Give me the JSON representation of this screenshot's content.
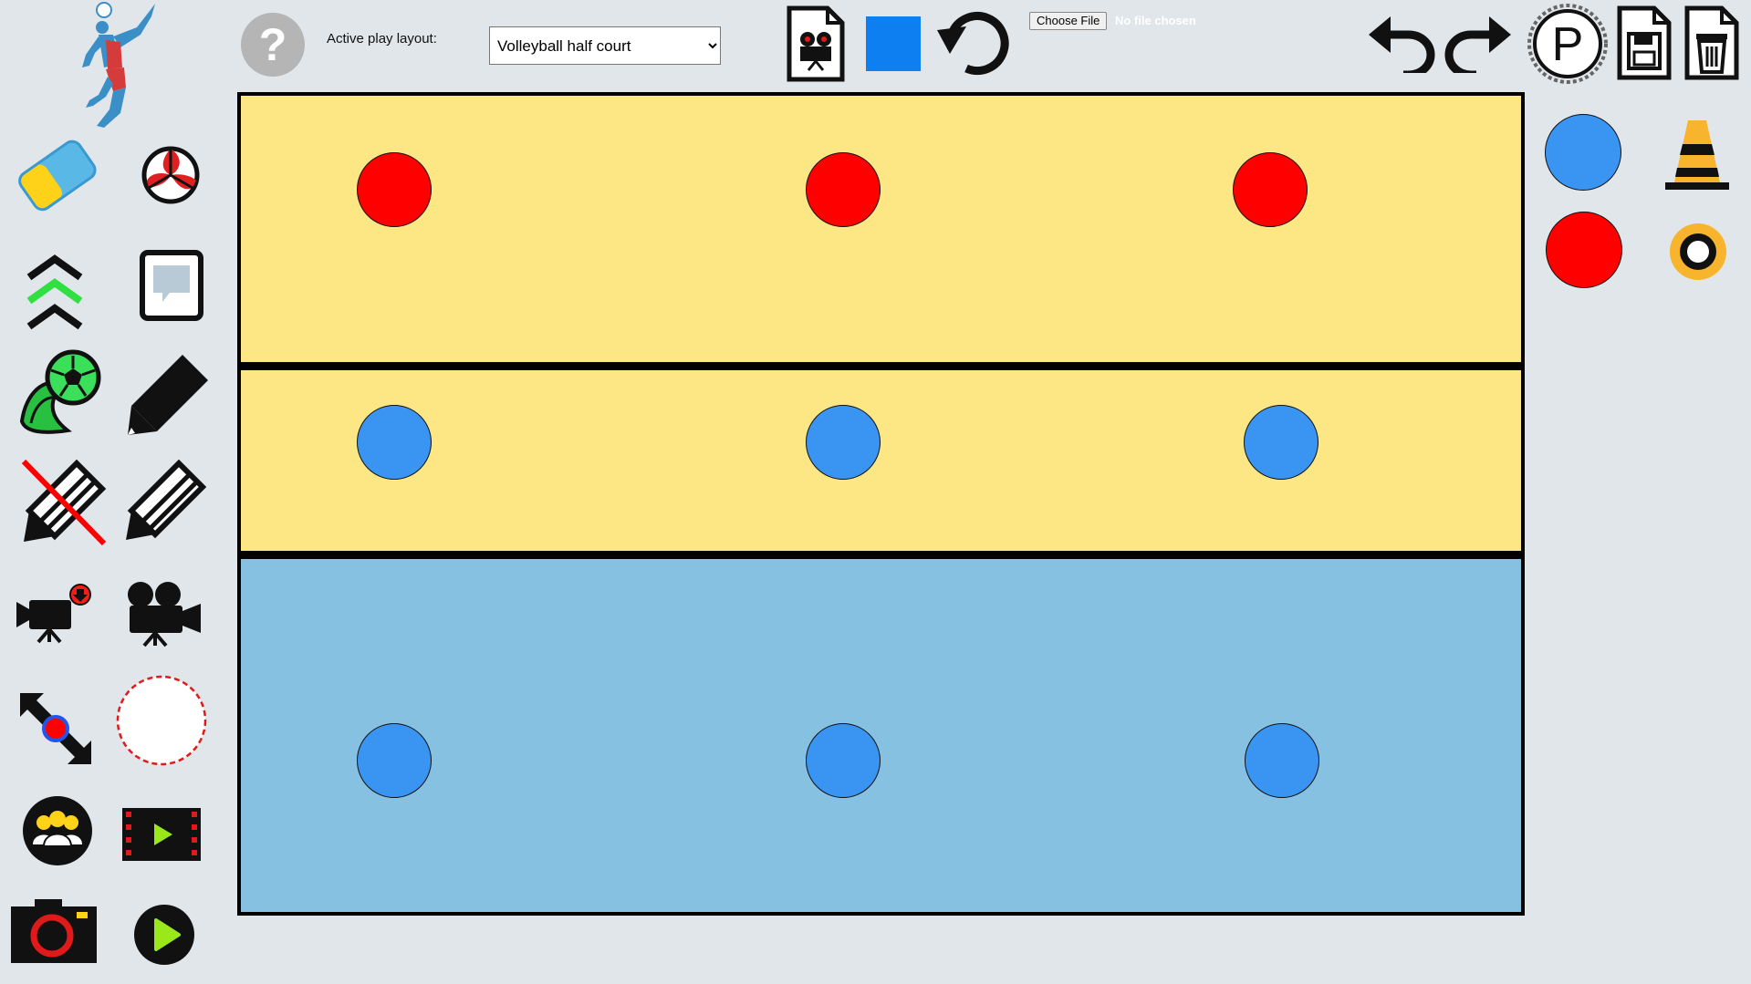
{
  "header": {
    "help_symbol": "?",
    "layout_label": "Active play layout:",
    "layout_options": [
      "Volleyball half court"
    ],
    "layout_selected": "Volleyball half court",
    "file_button_label": "Choose File",
    "file_status": "No file chosen",
    "selected_color": "#0e7ff0",
    "parking_letter": "P"
  },
  "colors": {
    "background": "#e1e6ea",
    "court_front": "#fde784",
    "court_back": "#86c1e1",
    "team_red": "#ff0000",
    "team_blue": "#3a95f2"
  },
  "left_toolbar": [
    "volleyball-player-logo",
    "eraser-icon",
    "volleyball-icon",
    "layer-up-icon",
    "comment-icon",
    "kicked-ball-icon",
    "pen-icon",
    "no-draw-icon",
    "pencil-icon",
    "record-video-icon",
    "video-camera-icon",
    "resize-move-icon",
    "selection-circle-icon",
    "team-icon",
    "film-play-icon",
    "camera-icon",
    "play-icon"
  ],
  "right_palette": [
    "blue-player-token",
    "cone-icon",
    "red-player-token",
    "ring-marker-icon"
  ],
  "players": [
    {
      "team": "red"
    },
    {
      "team": "red"
    },
    {
      "team": "red"
    },
    {
      "team": "blue"
    },
    {
      "team": "blue"
    },
    {
      "team": "blue"
    },
    {
      "team": "blue"
    },
    {
      "team": "blue"
    },
    {
      "team": "blue"
    }
  ]
}
